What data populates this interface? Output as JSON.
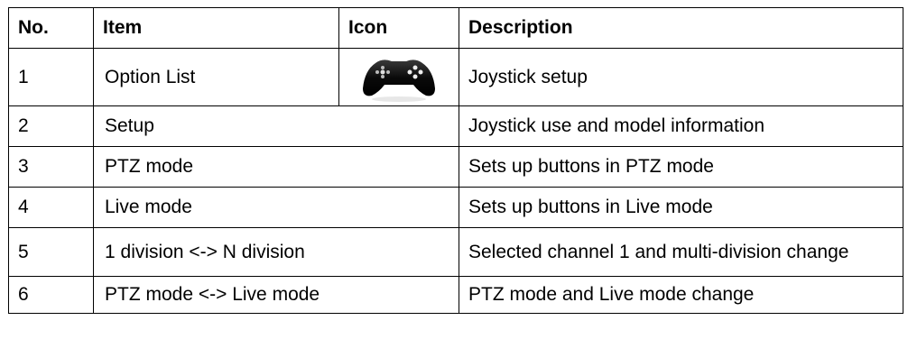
{
  "table": {
    "headers": {
      "no": "No.",
      "item": "Item",
      "icon": "Icon",
      "description": "Description"
    },
    "rows": [
      {
        "no": "1",
        "item": "Option List",
        "icon": "gamepad-icon",
        "description": "Joystick setup"
      },
      {
        "no": "2",
        "item": "Setup",
        "description": "Joystick use and model information"
      },
      {
        "no": "3",
        "item": "PTZ mode",
        "description": "Sets up buttons in PTZ mode"
      },
      {
        "no": "4",
        "item": "Live mode",
        "description": "Sets up buttons in Live mode"
      },
      {
        "no": "5",
        "item": "1 division <-> N division",
        "description": "Selected channel 1 and multi-division change"
      },
      {
        "no": "6",
        "item": "PTZ mode <-> Live mode",
        "description": "PTZ mode and Live mode change"
      }
    ]
  }
}
